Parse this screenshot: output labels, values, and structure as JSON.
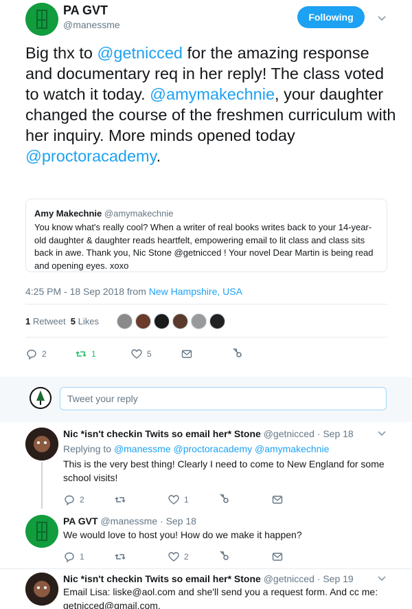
{
  "main_tweet": {
    "display_name": "PA GVT",
    "handle": "@manessme",
    "follow_label": "Following",
    "text": {
      "p1": "Big thx to ",
      "m1": "@getnicced",
      "p2": " for the amazing response and documentary req in her reply! The class voted to watch it today. ",
      "m2": "@amymakechnie",
      "p3": ", your daughter changed the course of the freshmen curriculum with her inquiry. More minds opened today ",
      "m3": "@proctoracademy",
      "p4": "."
    },
    "quote": {
      "name": "Amy Makechnie",
      "handle": "@amymakechnie",
      "text": "You know what's really cool? When a writer of real books writes back to your 14-year-old daughter & daughter reads heartfelt, empowering email to lit class and class sits back in awe. Thank you, Nic Stone @getnicced ! Your novel Dear Martin is being read and opening eyes. xoxo"
    },
    "timestamp": "4:25 PM - 18 Sep 2018 from ",
    "location": "New Hampshire, USA",
    "retweets_count": "1",
    "retweets_label": "Retweet",
    "likes_count": "5",
    "likes_label": "Likes",
    "actions": {
      "replies": "2",
      "retweets": "1",
      "likes": "5"
    }
  },
  "reply_box": {
    "placeholder": "Tweet your reply"
  },
  "replies": [
    {
      "name": "Nic *isn't checkin Twits so email her* Stone",
      "handle": "@getnicced",
      "date": "Sep 18",
      "replying_prefix": "Replying to",
      "replying_to": "@manessme @proctoracademy @amymakechnie",
      "text": "This is the very best thing! Clearly I need to come to New England for some school visits!",
      "replies": "2",
      "retweets": "",
      "likes": "1"
    },
    {
      "name": "PA GVT",
      "handle": "@manessme",
      "date": "Sep 18",
      "text": "We would love to host you! How do we make it happen?",
      "replies": "1",
      "retweets": "",
      "likes": "2"
    },
    {
      "name": "Nic *isn't checkin Twits so email her* Stone",
      "handle": "@getnicced",
      "date": "Sep 19",
      "text": "Email Lisa: liske@aol.com and she'll send you a request form. And cc me: getnicced@gmail.com."
    }
  ],
  "colors": {
    "accent": "#1da1f2",
    "retweet_green": "#17bf63",
    "brand_green": "#119c3e"
  }
}
